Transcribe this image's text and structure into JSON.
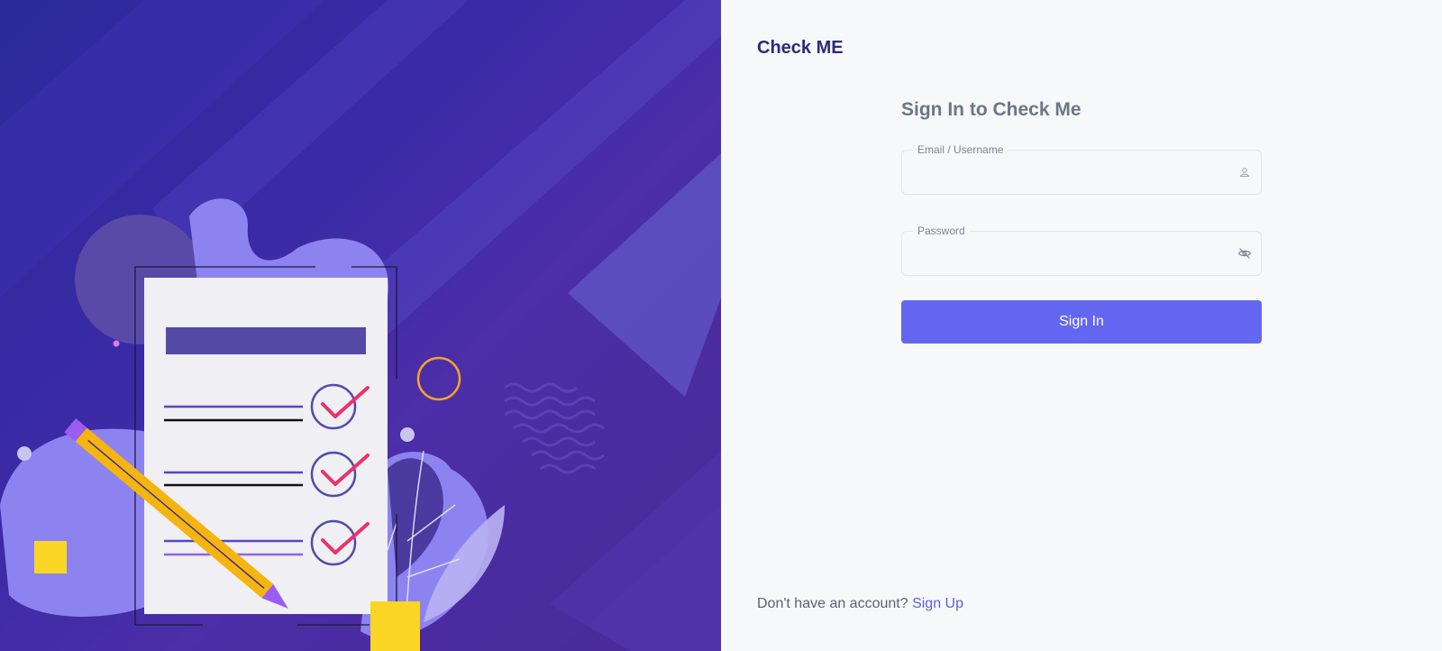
{
  "brand": "Check ME",
  "form": {
    "title": "Sign In to Check Me",
    "email": {
      "label": "Email / Username",
      "value": "",
      "icon": "user-icon"
    },
    "password": {
      "label": "Password",
      "value": "",
      "icon": "eye-off-icon"
    },
    "submit_label": "Sign In"
  },
  "footer": {
    "prompt": "Don't have an account?",
    "link": "Sign Up"
  },
  "colors": {
    "accent": "#6366f1",
    "brand": "#2e2a7a",
    "check": "#e8336a",
    "pencil": "#f5b40f"
  }
}
